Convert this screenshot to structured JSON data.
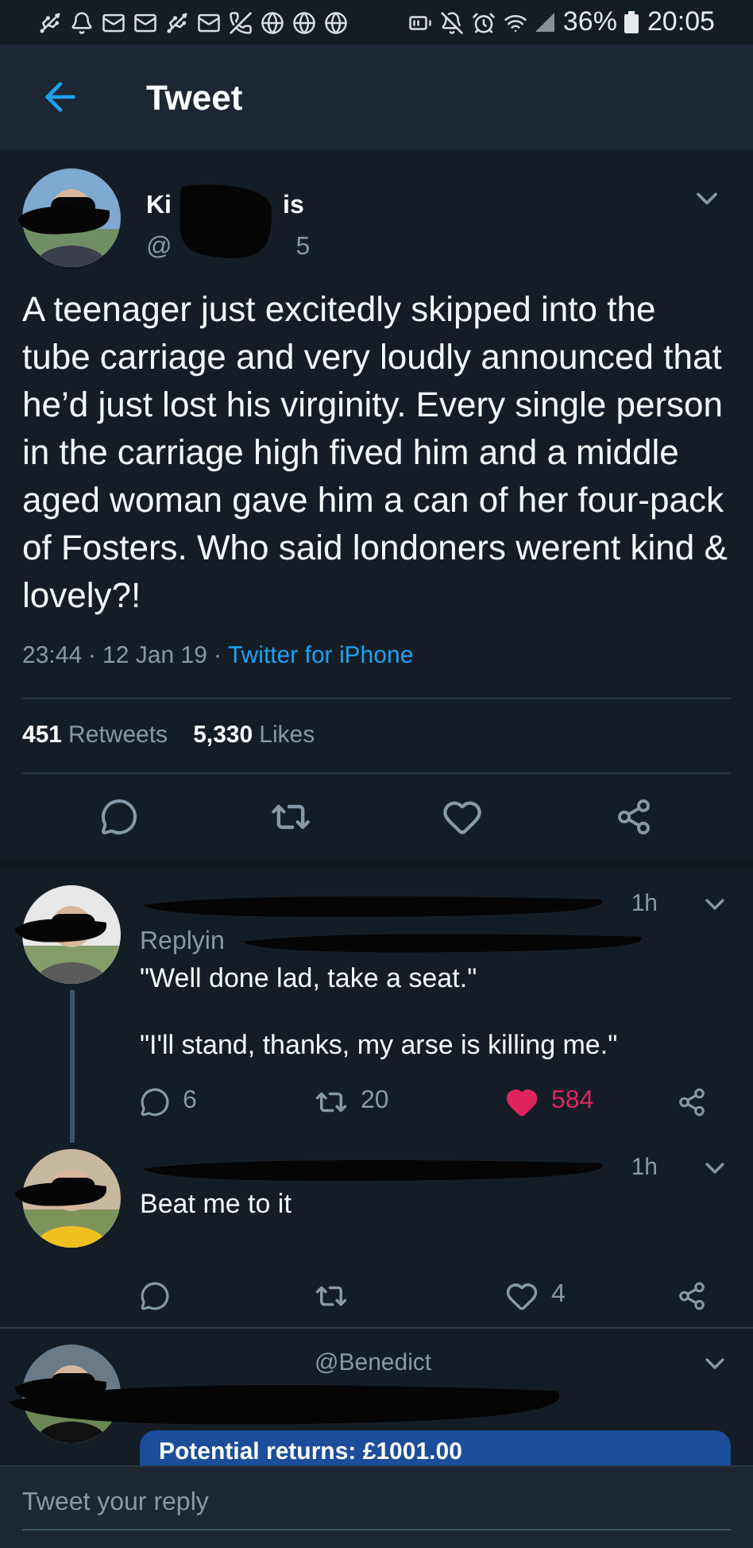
{
  "status_bar": {
    "battery": "36%",
    "time": "20:05"
  },
  "header": {
    "title": "Tweet"
  },
  "tweet": {
    "name_start": "Ki",
    "name_end": "is",
    "handle_start": "@",
    "handle_end": "5",
    "text": "A teenager just excitedly skipped into the tube carriage and very loudly announced that he’d just lost his virginity. Every single person in the carriage high fived him and a middle aged woman gave him a can of her four-pack of Fosters. Who said londoners werent kind & lovely?!",
    "time": "23:44",
    "separator": "·",
    "date": "12 Jan 19",
    "source": "Twitter for iPhone",
    "retweets": {
      "count": "451",
      "label": "Retweets"
    },
    "likes": {
      "count": "5,330",
      "label": "Likes"
    }
  },
  "replies": [
    {
      "time": "1h",
      "replying": "Replyin",
      "paragraphs": [
        "\"Well done lad, take a seat.\"",
        "\"I'll stand, thanks, my arse is killing me.\""
      ],
      "reply_count": "6",
      "retweet_count": "20",
      "like_count": "584",
      "liked": true,
      "thread": true
    },
    {
      "time": "1h",
      "paragraphs": [
        "Beat me to it"
      ],
      "like_count": "4",
      "liked": false,
      "thread": false
    },
    {
      "handle": "@Benedict",
      "card": "Potential returns: £1001.00",
      "thread": false
    }
  ],
  "composer": {
    "placeholder": "Tweet your reply"
  }
}
